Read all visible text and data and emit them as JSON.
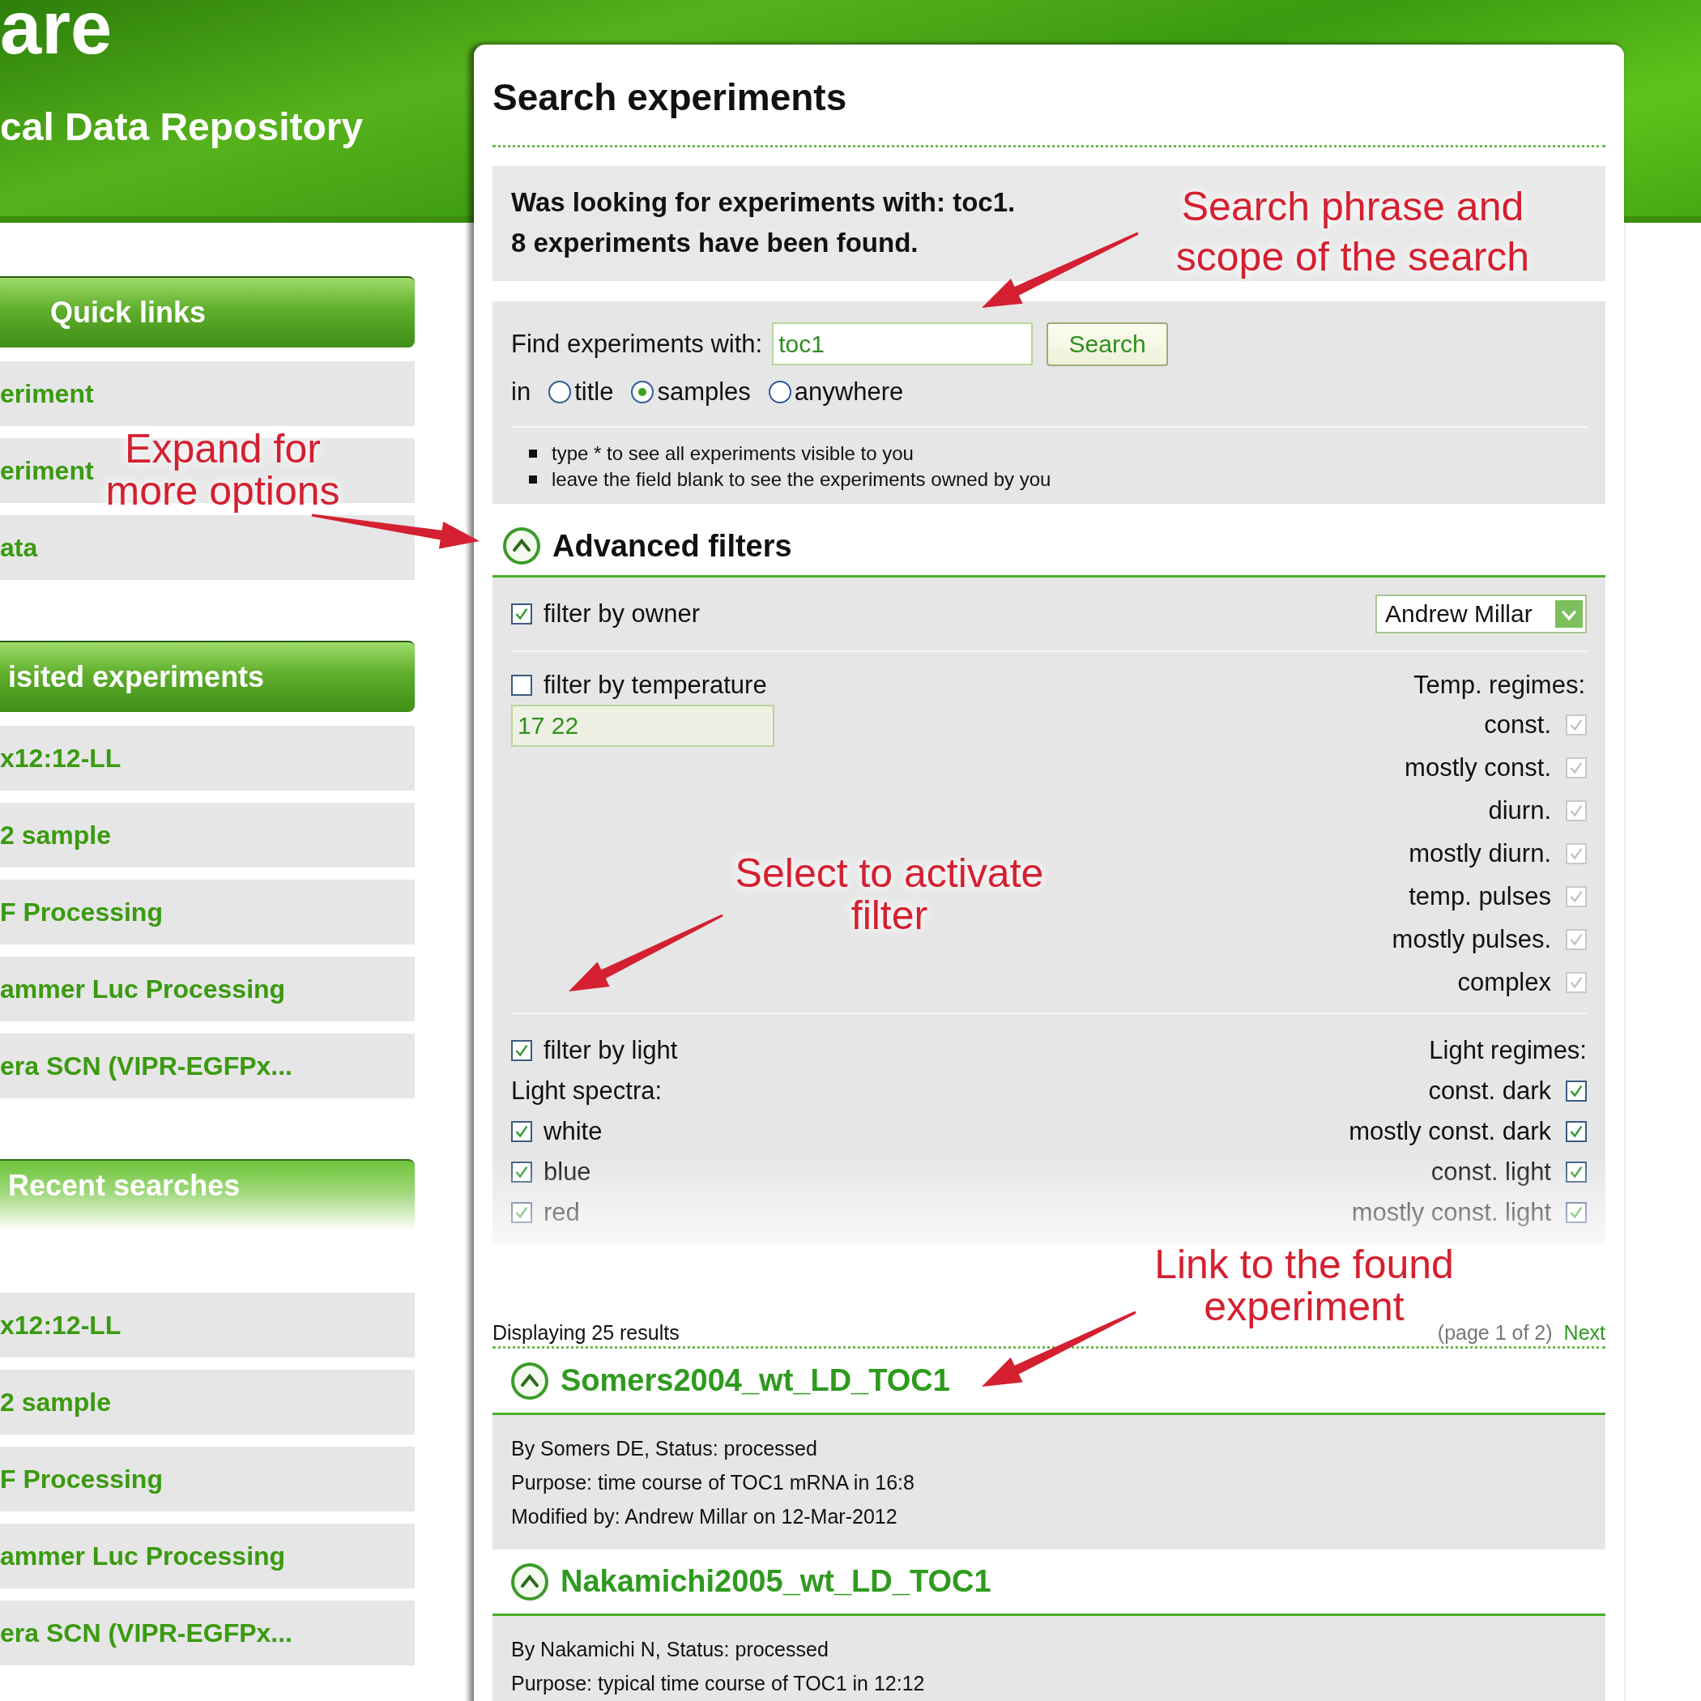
{
  "header": {
    "title": "are",
    "subtitle": "cal Data Repository"
  },
  "sidebar": [
    {
      "title": "Quick links",
      "items": [
        "eriment",
        "eriment",
        "ata"
      ]
    },
    {
      "title": "isited experiments",
      "items": [
        "x12:12-LL",
        "2 sample",
        "F Processing",
        "ammer Luc Processing",
        "era SCN (VIPR-EGFPx..."
      ]
    },
    {
      "title": "Recent searches",
      "items": [
        "x12:12-LL",
        "2 sample",
        "F Processing",
        "ammer Luc Processing",
        "era SCN (VIPR-EGFPx..."
      ]
    }
  ],
  "page_title": "Search experiments",
  "summary": [
    "Was looking for experiments with: toc1.",
    "8 experiments have been found."
  ],
  "search": {
    "label": "Find experiments with:",
    "value": "toc1",
    "button": "Search",
    "scope_label": "in",
    "scopes": [
      {
        "label": "title",
        "selected": false
      },
      {
        "label": "samples",
        "selected": true
      },
      {
        "label": "anywhere",
        "selected": false
      }
    ],
    "hints": [
      "type * to see all experiments visible to you",
      "leave the field blank to see the experiments owned by you"
    ]
  },
  "advanced_filters": {
    "title": "Advanced filters",
    "expanded": true,
    "owner": {
      "label": "filter by owner",
      "checked": true,
      "value": "Andrew Millar"
    },
    "temperature": {
      "label": "filter by temperature",
      "checked": false,
      "value": "17 22",
      "regimes_label": "Temp. regimes:",
      "regimes": [
        {
          "label": "const.",
          "checked": true,
          "disabled": true
        },
        {
          "label": "mostly const.",
          "checked": true,
          "disabled": true
        },
        {
          "label": "diurn.",
          "checked": true,
          "disabled": true
        },
        {
          "label": "mostly diurn.",
          "checked": true,
          "disabled": true
        },
        {
          "label": "temp. pulses",
          "checked": true,
          "disabled": true
        },
        {
          "label": "mostly pulses.",
          "checked": true,
          "disabled": true
        },
        {
          "label": "complex",
          "checked": true,
          "disabled": true
        }
      ]
    },
    "light": {
      "label": "filter by light",
      "checked": true,
      "spectra_label": "Light spectra:",
      "spectra": [
        {
          "label": "white",
          "checked": true
        },
        {
          "label": "blue",
          "checked": true
        },
        {
          "label": "red",
          "checked": true
        }
      ],
      "regimes_label": "Light regimes:",
      "regimes": [
        {
          "label": "const. dark",
          "checked": true
        },
        {
          "label": "mostly const. dark",
          "checked": true
        },
        {
          "label": "const. light",
          "checked": true
        },
        {
          "label": "mostly const. light",
          "checked": true
        }
      ]
    }
  },
  "results": {
    "count": "Displaying 25 results",
    "page": "(page 1 of 2)",
    "next": "Next",
    "items": [
      {
        "title": "Somers2004_wt_LD_TOC1",
        "expanded": true,
        "lines": [
          "By Somers DE, Status: processed",
          "Purpose: time course of TOC1 mRNA in 16:8",
          "Modified by: Andrew Millar on 12-Mar-2012"
        ]
      },
      {
        "title": "Nakamichi2005_wt_LD_TOC1",
        "expanded": true,
        "lines": [
          "By Nakamichi N, Status: processed",
          "Purpose: typical time course of TOC1 in 12:12"
        ]
      }
    ]
  },
  "annotations": [
    {
      "text": "Search phrase and\nscope of the search"
    },
    {
      "text": "Expand for\nmore options"
    },
    {
      "text": "Select to activate\nfilter"
    },
    {
      "text": "Link to the found\nexperiment"
    }
  ]
}
